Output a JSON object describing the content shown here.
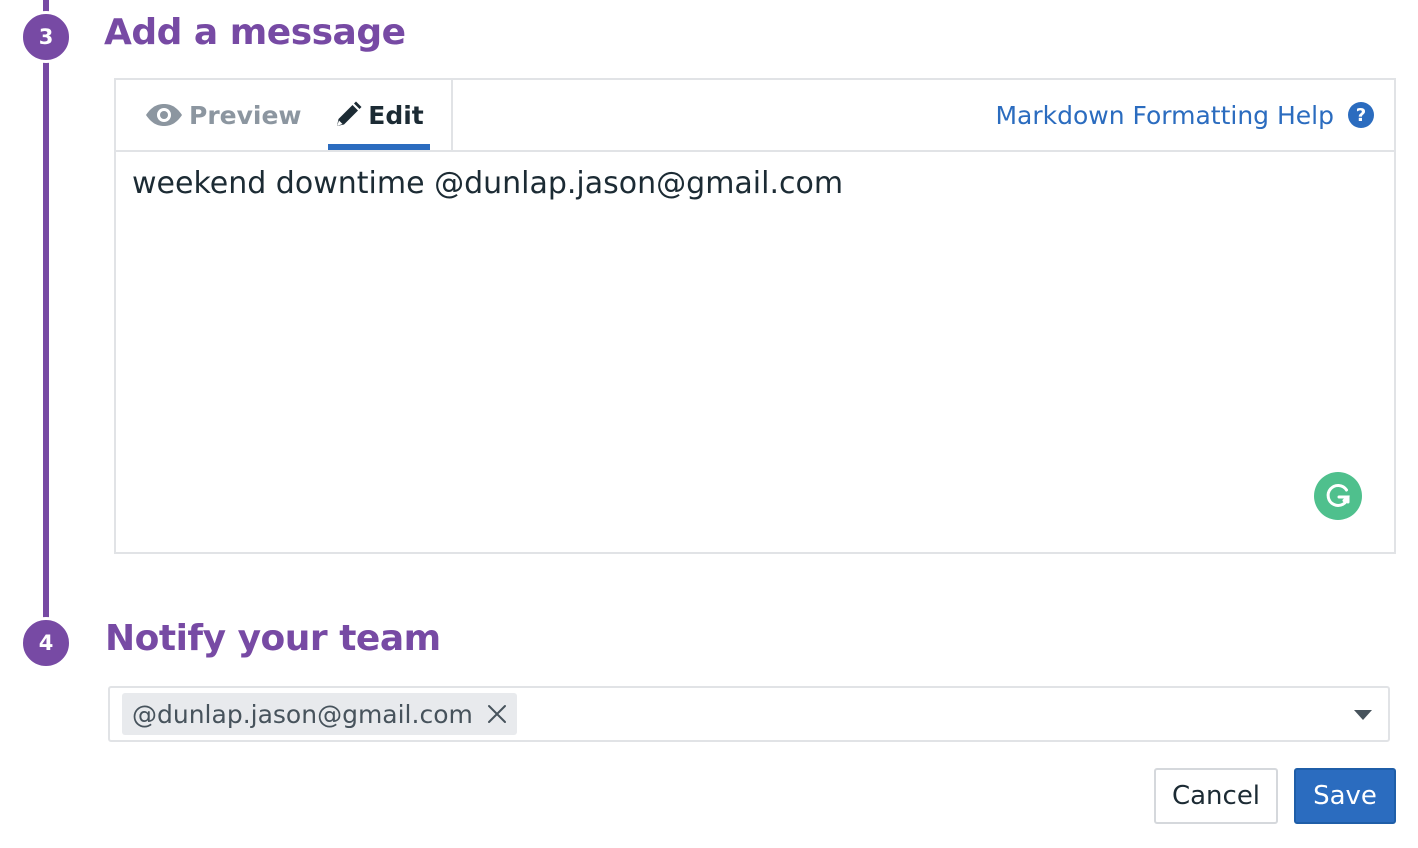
{
  "steps": {
    "message": {
      "number": "3",
      "title": "Add a message"
    },
    "notify": {
      "number": "4",
      "title": "Notify your team"
    }
  },
  "editor": {
    "tabs": {
      "preview": {
        "label": "Preview",
        "icon": "eye-icon"
      },
      "edit": {
        "label": "Edit",
        "icon": "pencil-icon",
        "active": true
      }
    },
    "help_link": {
      "label": "Markdown Formatting Help",
      "icon": "question-circle-icon"
    },
    "message_text": "weekend downtime @dunlap.jason@gmail.com",
    "grammarly_icon": "grammarly-icon"
  },
  "notify": {
    "selected_recipients": [
      "@dunlap.jason@gmail.com"
    ],
    "dropdown_icon": "caret-down-icon"
  },
  "actions": {
    "cancel_label": "Cancel",
    "save_label": "Save"
  },
  "colors": {
    "accent_purple": "#774aa4",
    "link_blue": "#2b6cbf",
    "grammarly_green": "#4fc08d"
  }
}
